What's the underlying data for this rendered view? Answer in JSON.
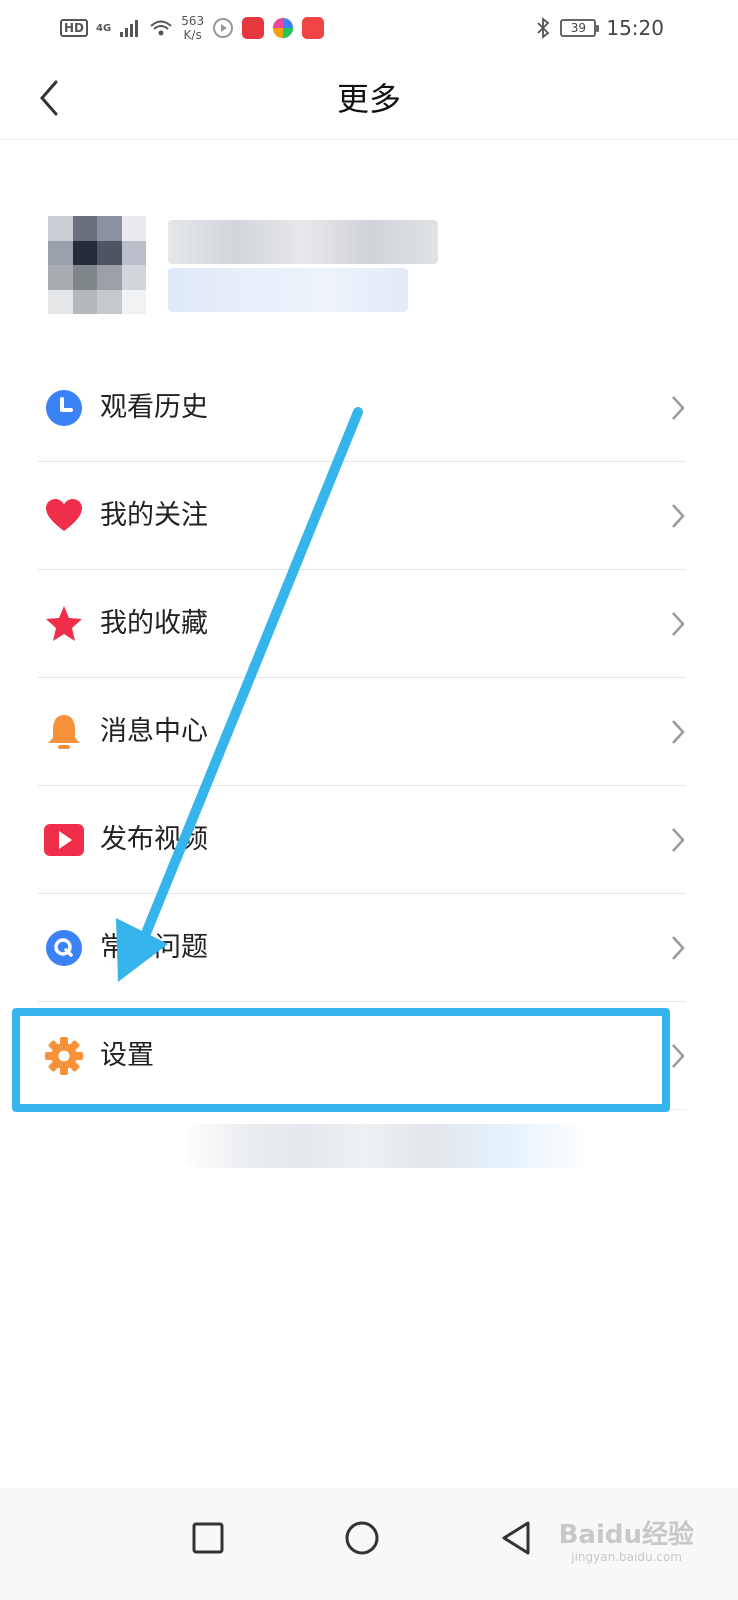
{
  "status_bar": {
    "hd": "HD",
    "network": "4G",
    "speed_value": "563",
    "speed_unit": "K/s",
    "battery": "39",
    "time": "15:20"
  },
  "header": {
    "title": "更多"
  },
  "menu": {
    "items": [
      {
        "label": "观看历史",
        "icon": "clock-icon",
        "color": "#3b82f6"
      },
      {
        "label": "我的关注",
        "icon": "heart-icon",
        "color": "#ef2f4a"
      },
      {
        "label": "我的收藏",
        "icon": "star-icon",
        "color": "#ef2f4a"
      },
      {
        "label": "消息中心",
        "icon": "bell-icon",
        "color": "#f7923a"
      },
      {
        "label": "发布视频",
        "icon": "play-icon",
        "color": "#ef2f4a"
      },
      {
        "label": "常见问题",
        "icon": "question-icon",
        "color": "#3b82f6"
      },
      {
        "label": "设置",
        "icon": "gear-icon",
        "color": "#f7923a"
      }
    ]
  },
  "annotation": {
    "color": "#35b5ec"
  },
  "watermark": {
    "brand": "Baidu经验",
    "domain": "jingyan.baidu.com"
  }
}
